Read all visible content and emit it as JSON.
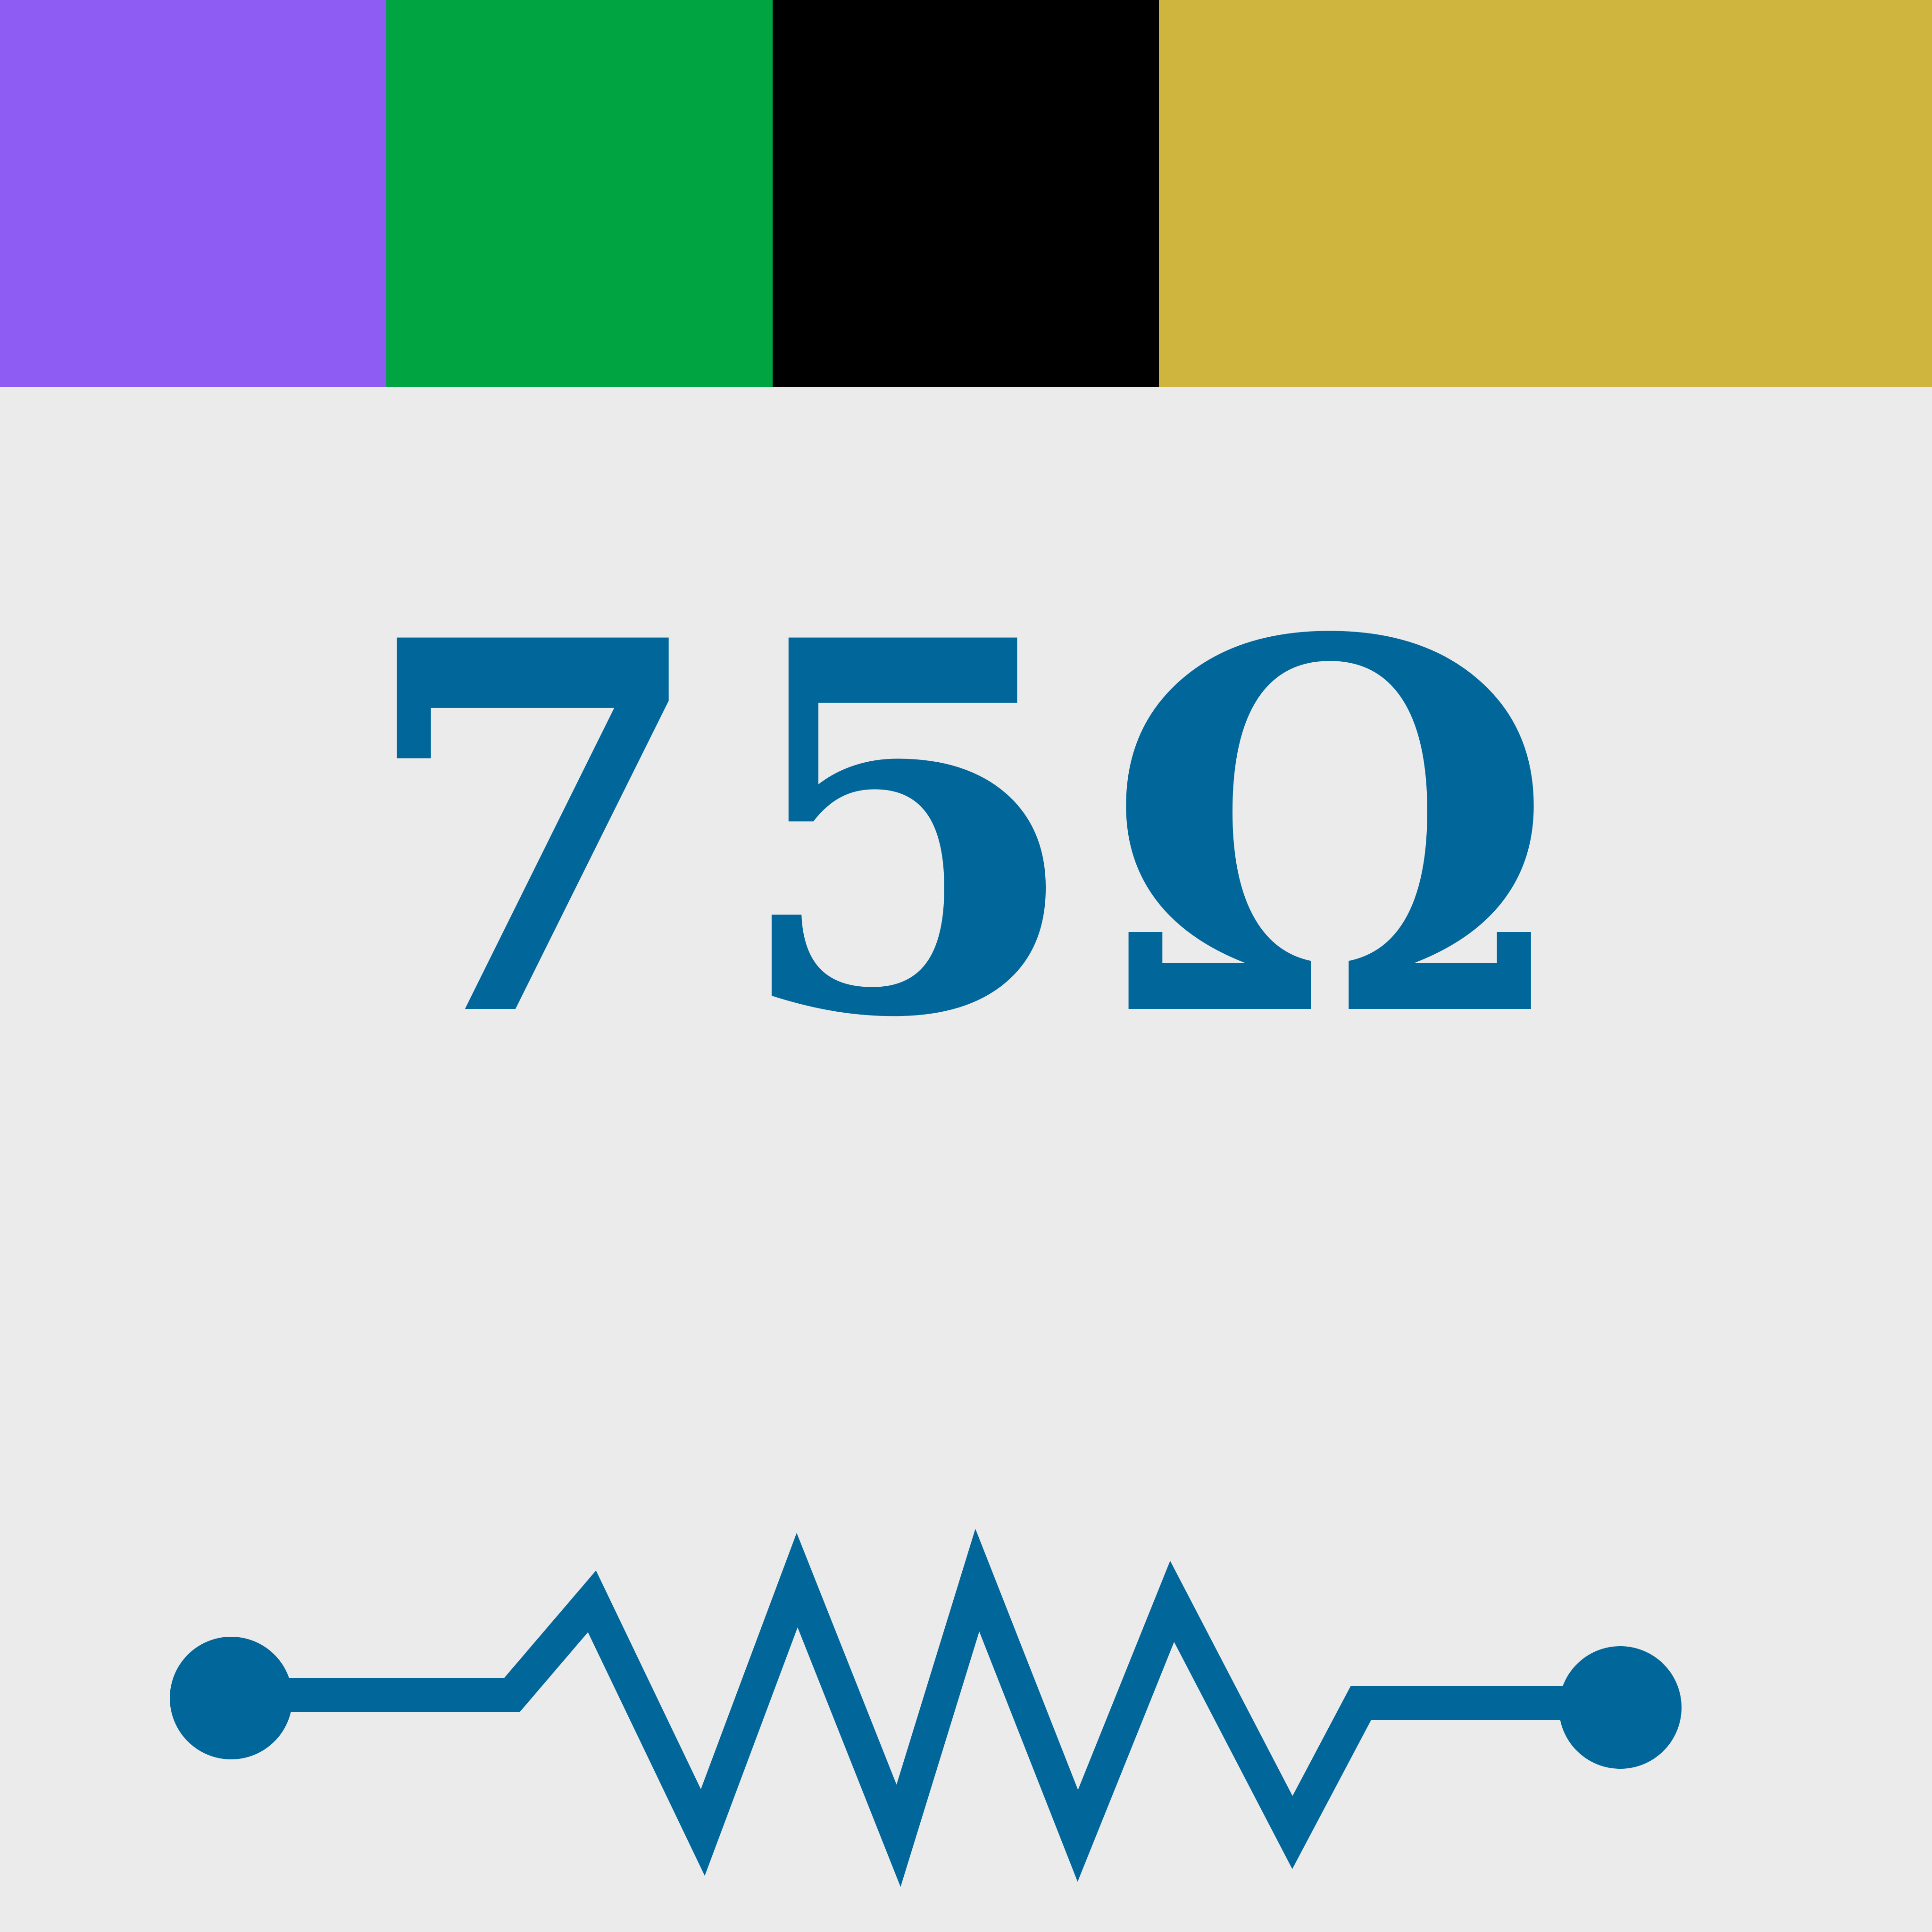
{
  "bands": [
    {
      "name": "violet",
      "color": "#8e5cf2"
    },
    {
      "name": "green",
      "color": "#00a542"
    },
    {
      "name": "black",
      "color": "#000000"
    },
    {
      "name": "gold",
      "color": "#cfb43d"
    }
  ],
  "resistance_label": "75Ω",
  "accent_color": "#016699",
  "background_color": "#ebebeb",
  "icons": {
    "resistor": "resistor-symbol-icon"
  }
}
